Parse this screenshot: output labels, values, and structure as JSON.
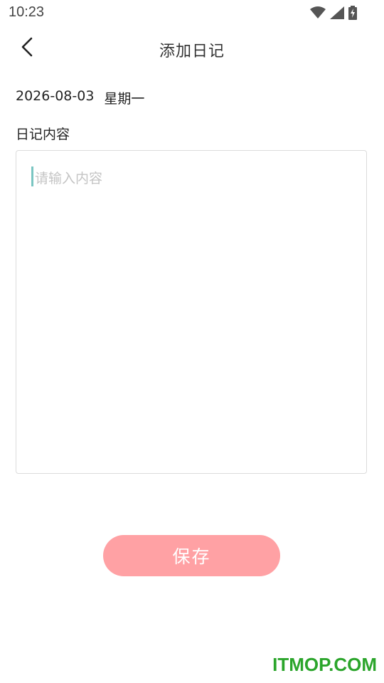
{
  "status_bar": {
    "time": "10:23",
    "icons": [
      "wifi-icon",
      "cell-signal-icon",
      "battery-charging-icon"
    ]
  },
  "header": {
    "title": "添加日记",
    "back_icon": "chevron-left-icon"
  },
  "entry": {
    "date": "2026-08-03",
    "weekday": "星期一"
  },
  "content": {
    "label": "日记内容",
    "placeholder": "请输入内容",
    "value": ""
  },
  "save_button": {
    "label": "保存",
    "color": "#ffa1a4"
  },
  "watermark": {
    "text": "ITMOP.COM",
    "color": "#2ba52b"
  },
  "colors": {
    "caret": "#7ac5c2",
    "border": "#dcdcdc"
  }
}
